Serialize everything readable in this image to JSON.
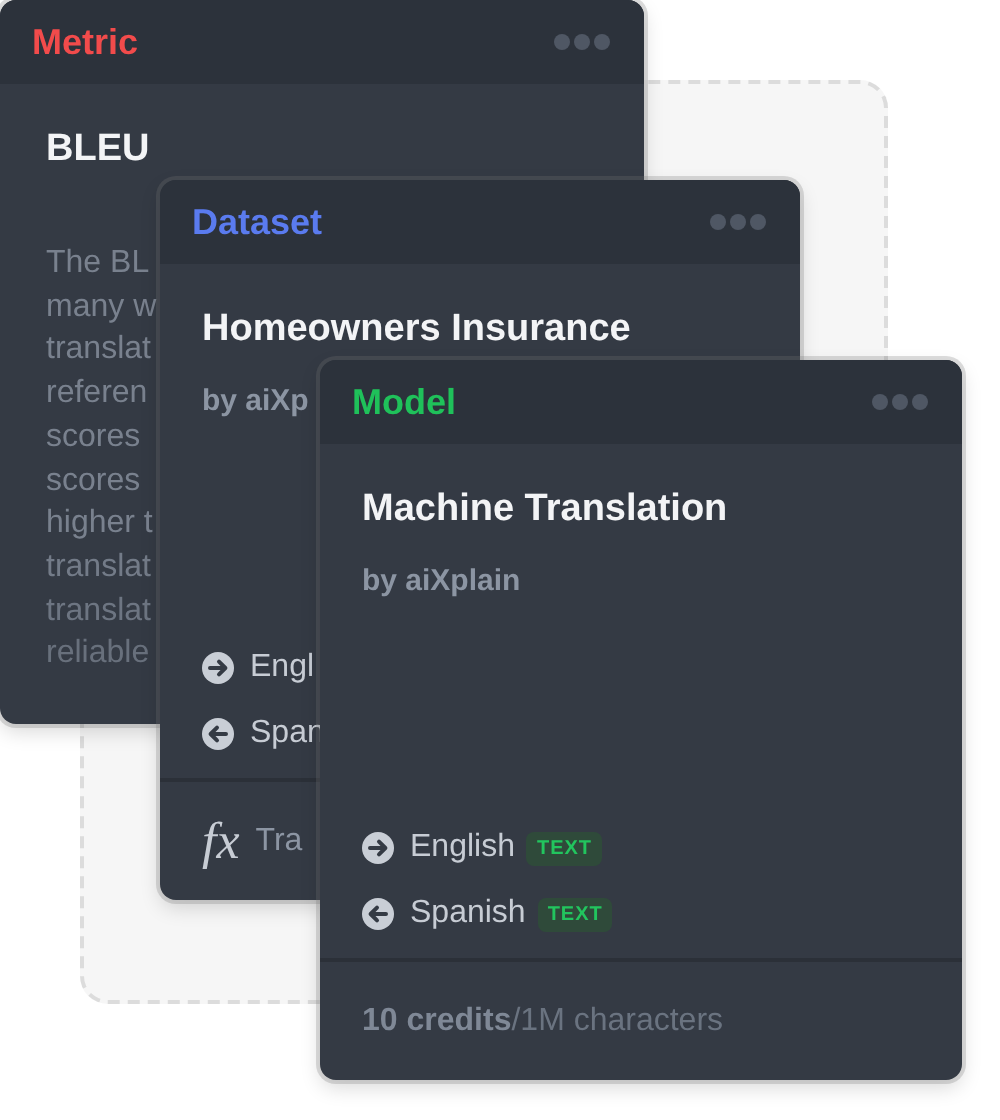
{
  "cards": [
    {
      "kind": "metric",
      "label": "Metric",
      "color": "#f24b4b",
      "name": "BLEU",
      "description": [
        "The BL",
        "many w",
        "translat",
        "referen",
        "scores",
        "scores",
        "higher t",
        "translat",
        "translat",
        "reliable"
      ]
    },
    {
      "kind": "dataset",
      "label": "Dataset",
      "color": "#5a7bef",
      "name": "Homeowners Insurance",
      "author": "by aiXp",
      "io": [
        {
          "kind": "input",
          "language": "Engl"
        },
        {
          "kind": "output",
          "language": "Span"
        }
      ],
      "function_icon": "fx",
      "function": "Tra"
    },
    {
      "kind": "model",
      "label": "Model",
      "color": "#1fc15a",
      "name": "Machine Translation",
      "author": "by aiXplain",
      "io": [
        {
          "kind": "input",
          "language": "English",
          "badge": "TEXT"
        },
        {
          "kind": "output",
          "language": "Spanish",
          "badge": "TEXT"
        }
      ],
      "credits": "10 credits",
      "unit": "/1M characters"
    }
  ]
}
